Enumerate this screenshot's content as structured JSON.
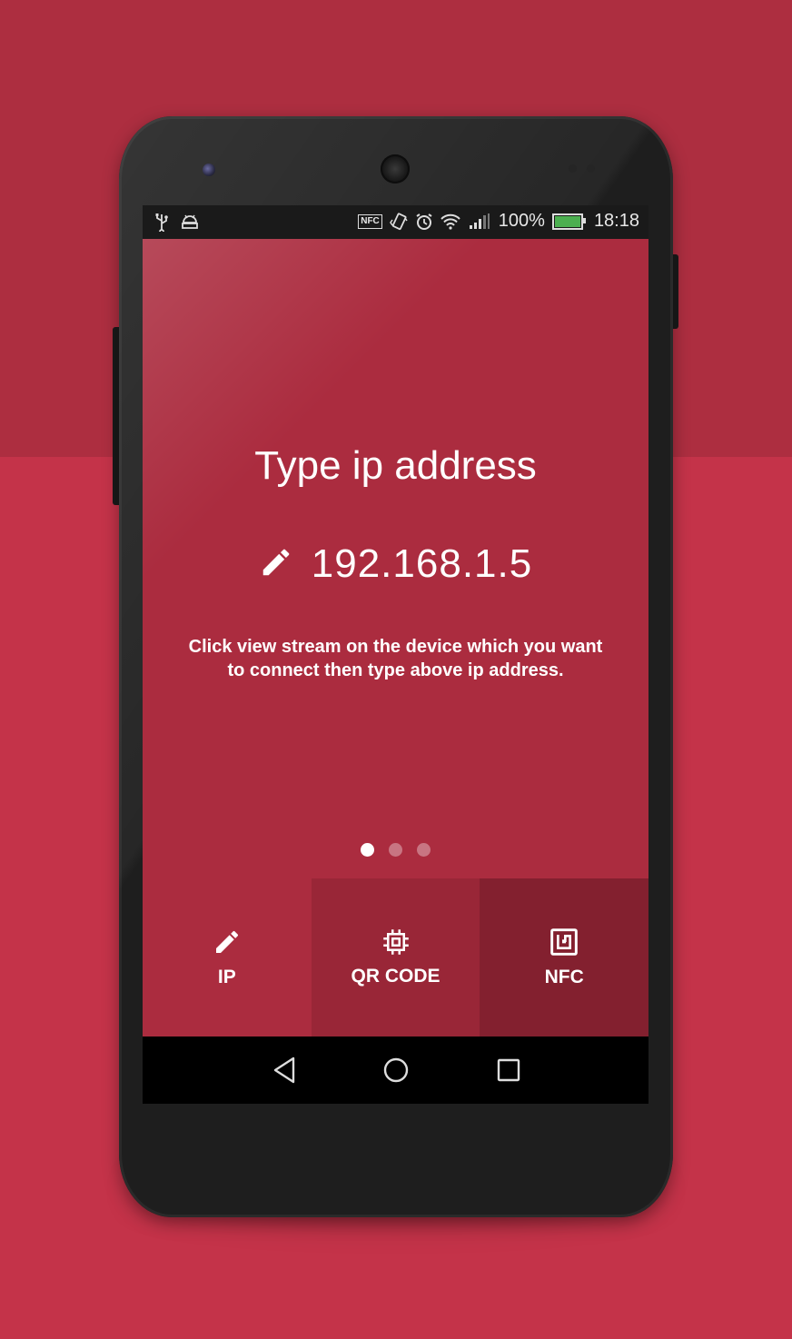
{
  "colors": {
    "background_top": "#ad2e40",
    "background_bottom": "#c43349",
    "screen": "#ab2c3f",
    "tab_qr": "#992637",
    "tab_nfc": "#83202f",
    "status_bar": "#1a1a1a",
    "battery_fill": "#4caf50"
  },
  "status_bar": {
    "left_icons": [
      "usb-icon",
      "android-debug-icon"
    ],
    "right_icons": [
      "nfc-icon",
      "vibrate-icon",
      "alarm-icon",
      "wifi-icon",
      "signal-icon"
    ],
    "nfc_text": "NFC",
    "battery_percent": "100%",
    "battery_level": 1.0,
    "time": "18:18"
  },
  "main": {
    "title": "Type ip address",
    "ip_value": "192.168.1.5",
    "ip_icon": "pencil-icon",
    "description": "Click view stream on the device which you want to connect then type above ip address."
  },
  "pager": {
    "count": 3,
    "active_index": 0
  },
  "tabs": [
    {
      "label": "IP",
      "icon": "pencil-icon"
    },
    {
      "label": "QR CODE",
      "icon": "chip-icon"
    },
    {
      "label": "NFC",
      "icon": "nfc-icon"
    }
  ],
  "nav_bar": {
    "buttons": [
      "back-icon",
      "home-icon",
      "recents-icon"
    ]
  }
}
